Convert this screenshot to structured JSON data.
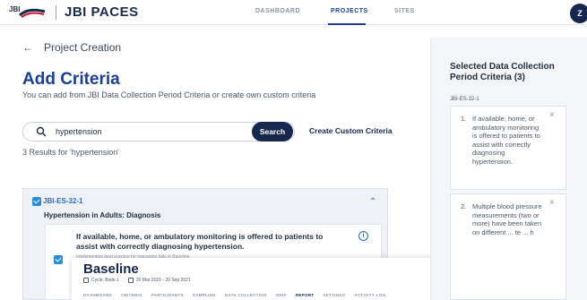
{
  "header": {
    "logo_small": "JBI",
    "brand": "JBI PACES",
    "nav": [
      "DASHBOARD",
      "PROJECTS",
      "SITES"
    ],
    "active_nav": "PROJECTS",
    "avatar_initial": "Z"
  },
  "breadcrumb": {
    "back_label": "Project Creation"
  },
  "page": {
    "title": "Add Criteria",
    "subtitle": "You can add from JBI Data Collection Period Criteria or create own custom criteria"
  },
  "search": {
    "value": "hypertension",
    "button_label": "Search",
    "custom_link": "Create Custom Criteria",
    "results_text": "3 Results for 'hypertension'"
  },
  "result": {
    "code": "JBI-ES-32-1",
    "title": "Hypertension in Adults: Diagnosis",
    "criterion": "If available, home, or ambulatory monitoring is offered to patients to assist with correctly diagnosing hypertension.",
    "sub_text": "Implementing best practice for managing falls in Baseline"
  },
  "overlay": {
    "title": "Baseline",
    "meta": [
      "Cycle, Book 1",
      "20 Mar 2021 - 20 Sep 2021"
    ],
    "tabs": [
      "DASHBOARD",
      "CRITERIA",
      "PARTICIPANTS",
      "SAMPLING",
      "DATA COLLECTION",
      "GRIP",
      "REPORT",
      "SETTINGS",
      "ACTIVITY LOG"
    ],
    "active_tab": "REPORT"
  },
  "side": {
    "title": "Selected Data Collection Period Criteria (3)",
    "code": "JBI-ES-32-1",
    "items": [
      {
        "num": "1.",
        "text": "If available, home, or ambulatory monitoring is offered to patients to assist with correctly diagnosing hypertension."
      },
      {
        "num": "2.",
        "text": "Multiple blood pressure measurements (two or more) have been taken on different ... te ... h"
      }
    ]
  },
  "colors": {
    "brand": "#16274d",
    "accent": "#1c3f95",
    "link": "#2c6ec4",
    "check": "#2c8dd6"
  }
}
